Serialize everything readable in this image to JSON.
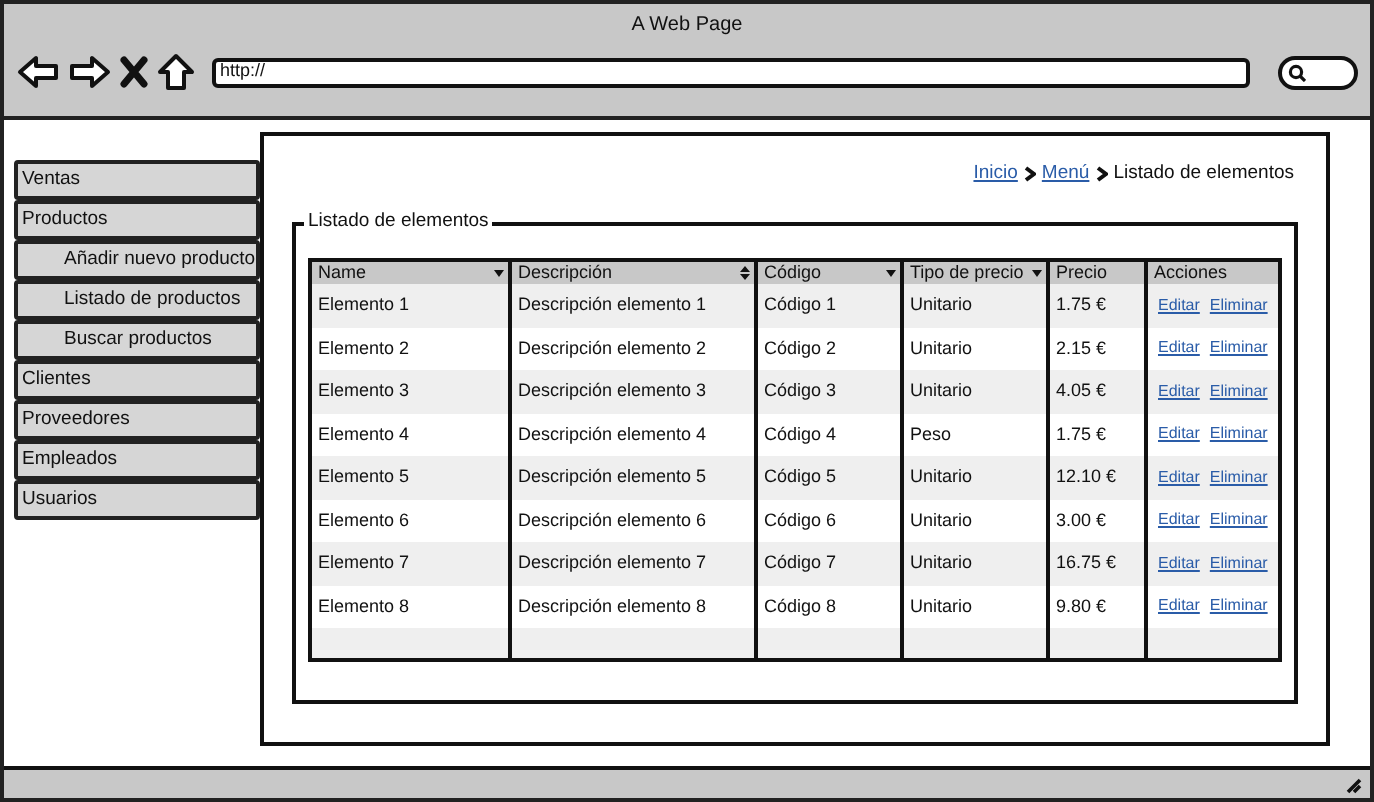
{
  "window": {
    "title": "A Web Page",
    "address": "http://"
  },
  "sidebar": {
    "items": [
      {
        "label": "Ventas"
      },
      {
        "label": "Productos",
        "children": [
          {
            "label": "Añadir nuevo producto"
          },
          {
            "label": "Listado de productos"
          },
          {
            "label": "Buscar productos"
          }
        ]
      },
      {
        "label": "Clientes"
      },
      {
        "label": "Proveedores"
      },
      {
        "label": "Empleados"
      },
      {
        "label": "Usuarios"
      }
    ]
  },
  "breadcrumb": [
    {
      "label": "Inicio",
      "kind": "link"
    },
    {
      "label": "Menú",
      "kind": "link"
    },
    {
      "label": "Listado de elementos",
      "kind": "current"
    }
  ],
  "group": {
    "title": "Listado de elementos"
  },
  "table": {
    "columns": [
      {
        "label": "Name",
        "kind": "dropdown"
      },
      {
        "label": "Descripción",
        "kind": "sortable"
      },
      {
        "label": "Código",
        "kind": "dropdown"
      },
      {
        "label": "Tipo de precio",
        "kind": "dropdown"
      },
      {
        "label": "Precio",
        "kind": "plain"
      },
      {
        "label": "Acciones",
        "kind": "plain"
      }
    ],
    "rows": [
      {
        "cells": [
          "Elemento 1",
          "Descripción elemento 1",
          "Código 1",
          "Unitario",
          "1.75 €"
        ],
        "actions": [
          "Editar",
          "Eliminar"
        ]
      },
      {
        "cells": [
          "Elemento 2",
          "Descripción elemento 2",
          "Código 2",
          "Unitario",
          "2.15 €"
        ],
        "actions": [
          "Editar",
          "Eliminar"
        ]
      },
      {
        "cells": [
          "Elemento 3",
          "Descripción elemento 3",
          "Código 3",
          "Unitario",
          "4.05 €"
        ],
        "actions": [
          "Editar",
          "Eliminar"
        ]
      },
      {
        "cells": [
          "Elemento 4",
          "Descripción elemento 4",
          "Código 4",
          "Peso",
          "1.75 €"
        ],
        "actions": [
          "Editar",
          "Eliminar"
        ]
      },
      {
        "cells": [
          "Elemento 5",
          "Descripción elemento 5",
          "Código 5",
          "Unitario",
          "12.10 €"
        ],
        "actions": [
          "Editar",
          "Eliminar"
        ]
      },
      {
        "cells": [
          "Elemento 6",
          "Descripción elemento 6",
          "Código 6",
          "Unitario",
          "3.00 €"
        ],
        "actions": [
          "Editar",
          "Eliminar"
        ]
      },
      {
        "cells": [
          "Elemento 7",
          "Descripción elemento 7",
          "Código 7",
          "Unitario",
          "16.75 €"
        ],
        "actions": [
          "Editar",
          "Eliminar"
        ]
      },
      {
        "cells": [
          "Elemento 8",
          "Descripción elemento 8",
          "Código 8",
          "Unitario",
          "9.80 €"
        ],
        "actions": [
          "Editar",
          "Eliminar"
        ]
      }
    ]
  }
}
